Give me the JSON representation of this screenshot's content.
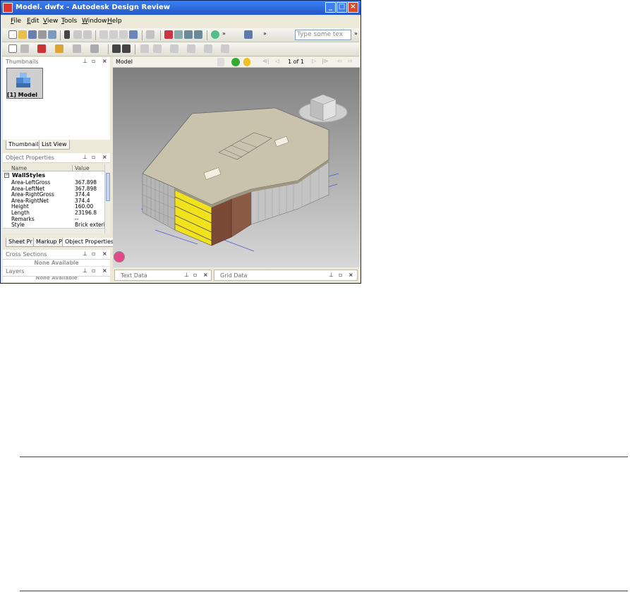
{
  "window": {
    "title": "Model. dwfx - Autodesk Design Review",
    "controls": {
      "minimize": "_",
      "maximize": "□",
      "close": "×"
    }
  },
  "menu": [
    {
      "u": "F",
      "rest": "ile"
    },
    {
      "u": "E",
      "rest": "dit"
    },
    {
      "u": "V",
      "rest": "iew"
    },
    {
      "u": "T",
      "rest": "ools"
    },
    {
      "u": "W",
      "rest": "indow"
    },
    {
      "u": "H",
      "rest": "elp"
    }
  ],
  "toolbar": {
    "search_text": "Type some tex",
    "overflow": "»"
  },
  "thumbnails_panel": {
    "title": "Thumbnails",
    "item_label": "[1] Model",
    "tabs": [
      "Thumbnails",
      "List View"
    ]
  },
  "object_properties": {
    "title": "Object Properties",
    "col_name": "Name",
    "col_value": "Value",
    "group": "WallStyles",
    "rows": [
      {
        "k": "Area-LeftGross",
        "v": "367.898"
      },
      {
        "k": "Area-LeftNet",
        "v": "367.898"
      },
      {
        "k": "Area-RightGross",
        "v": "374.4"
      },
      {
        "k": "Area-RightNet",
        "v": "374.4"
      },
      {
        "k": "Height",
        "v": "160.00"
      },
      {
        "k": "Length",
        "v": "23196.8"
      },
      {
        "k": "Remarks",
        "v": "--"
      },
      {
        "k": "Style",
        "v": "Brick exterior"
      }
    ],
    "tabs": [
      "Sheet Pr",
      "Markup Pr",
      "Object Properties"
    ]
  },
  "cross_sections": {
    "title": "Cross Sections",
    "empty": "None Available"
  },
  "layers": {
    "title": "Layers",
    "empty": "None Available"
  },
  "view": {
    "title": "Model",
    "page_indicator": "1 of 1"
  },
  "bottom_panels": {
    "text_data": "Text Data",
    "grid_data": "Grid Data"
  },
  "colors": {
    "title_bar": "#2a5fd8",
    "accent_yellow": "#f2e21c",
    "brick": "#7a4a36"
  }
}
